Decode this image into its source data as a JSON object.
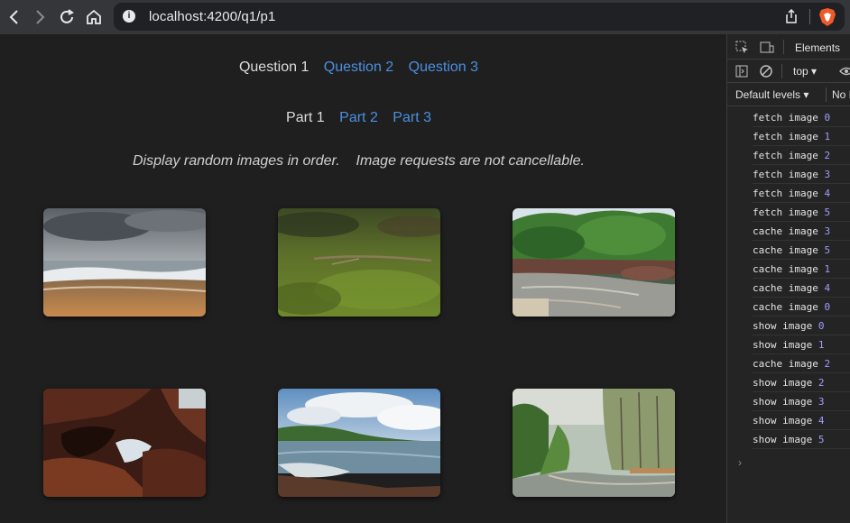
{
  "browser": {
    "url": "localhost:4200/q1/p1",
    "info_symbol": "i"
  },
  "page": {
    "question_tabs": [
      "Question 1",
      "Question 2",
      "Question 3"
    ],
    "part_tabs": [
      "Part 1",
      "Part 2",
      "Part 3"
    ],
    "description": "Display random images in order.    Image requests are not cancellable.",
    "images": [
      {
        "subject": "beach-shore"
      },
      {
        "subject": "mossy-ground"
      },
      {
        "subject": "forest-stream"
      },
      {
        "subject": "red-rocks"
      },
      {
        "subject": "coastal-bay"
      },
      {
        "subject": "winding-road"
      }
    ]
  },
  "devtools": {
    "tab_elements": "Elements",
    "context": "top",
    "levels": "Default levels",
    "no_issues": "No I",
    "logs": [
      {
        "msg": "fetch image",
        "num": "0"
      },
      {
        "msg": "fetch image",
        "num": "1"
      },
      {
        "msg": "fetch image",
        "num": "2"
      },
      {
        "msg": "fetch image",
        "num": "3"
      },
      {
        "msg": "fetch image",
        "num": "4"
      },
      {
        "msg": "fetch image",
        "num": "5"
      },
      {
        "msg": "cache image",
        "num": "3"
      },
      {
        "msg": "cache image",
        "num": "5"
      },
      {
        "msg": "cache image",
        "num": "1"
      },
      {
        "msg": "cache image",
        "num": "4"
      },
      {
        "msg": "cache image",
        "num": "0"
      },
      {
        "msg": "show image",
        "num": "0"
      },
      {
        "msg": "show image",
        "num": "1"
      },
      {
        "msg": "cache image",
        "num": "2"
      },
      {
        "msg": "show image",
        "num": "2"
      },
      {
        "msg": "show image",
        "num": "3"
      },
      {
        "msg": "show image",
        "num": "4"
      },
      {
        "msg": "show image",
        "num": "5"
      }
    ],
    "prompt": "›"
  },
  "colors": {
    "link": "#4a90e2",
    "active_tab": "#dcdcdc",
    "log_number": "#9d9dff",
    "brave_orange": "#f05a28"
  }
}
